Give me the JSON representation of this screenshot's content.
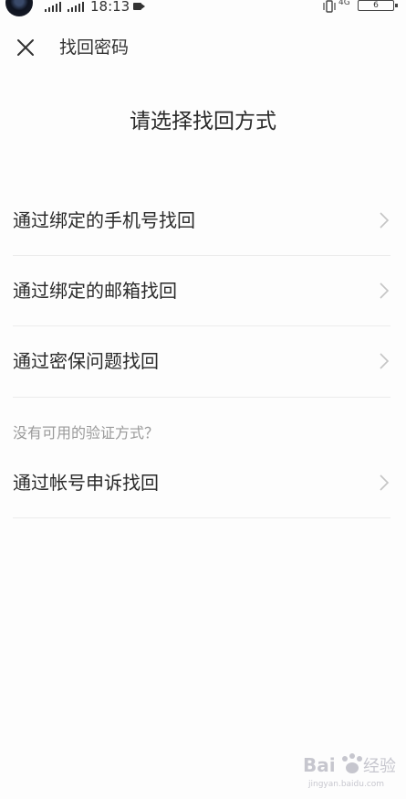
{
  "status_bar": {
    "time": "18:13",
    "network": "4G",
    "battery": "6"
  },
  "header": {
    "title": "找回密码"
  },
  "page": {
    "title": "请选择找回方式"
  },
  "options": [
    {
      "label": "通过绑定的手机号找回"
    },
    {
      "label": "通过绑定的邮箱找回"
    },
    {
      "label": "通过密保问题找回"
    }
  ],
  "alt_section": {
    "hint": "没有可用的验证方式？",
    "option_label": "通过帐号申诉找回"
  },
  "colors": {
    "background": "#fdfdfd",
    "text": "#2b2b2b",
    "hint": "#9a9a9a",
    "divider": "#ececec",
    "chevron": "#c4c4c4"
  },
  "icons": {
    "close": "close-icon",
    "chevron": "chevron-right-icon"
  }
}
